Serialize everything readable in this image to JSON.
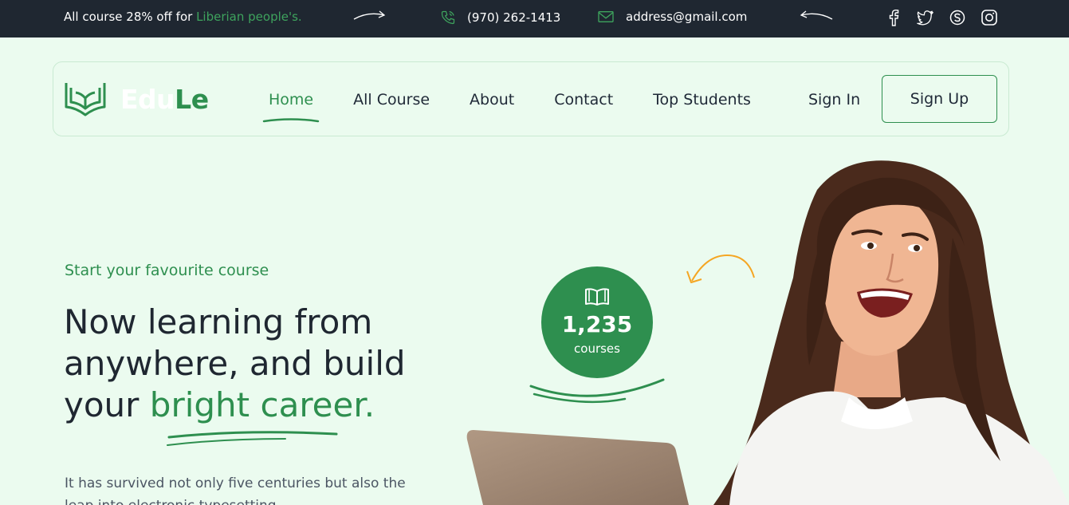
{
  "topbar": {
    "promo_text": "All course 28% off for ",
    "promo_highlight": "Liberian people's.",
    "phone": "(970) 262-1413",
    "email": "address@gmail.com",
    "socials": [
      "facebook-icon",
      "twitter-icon",
      "skype-icon",
      "instagram-icon"
    ]
  },
  "nav": {
    "brand_part1": "Edu",
    "brand_part2": "Le",
    "items": [
      {
        "label": "Home",
        "active": true
      },
      {
        "label": "All Course"
      },
      {
        "label": "About"
      },
      {
        "label": "Contact"
      },
      {
        "label": "Top Students"
      }
    ],
    "signin": "Sign In",
    "signup": "Sign Up"
  },
  "hero": {
    "kicker": "Start your favourite course",
    "headline_part1": "Now learning from anywhere, and build your ",
    "headline_highlight": "bright career.",
    "description": "It has survived not only five centuries but also the leap into electronic typesetting."
  },
  "badge": {
    "count": "1,235",
    "label": "courses",
    "icon": "open-book-icon"
  },
  "colors": {
    "accent": "#2e8f4f",
    "topbar_bg": "#1f2731",
    "page_bg": "#ebfbef",
    "orange": "#f5a623"
  }
}
